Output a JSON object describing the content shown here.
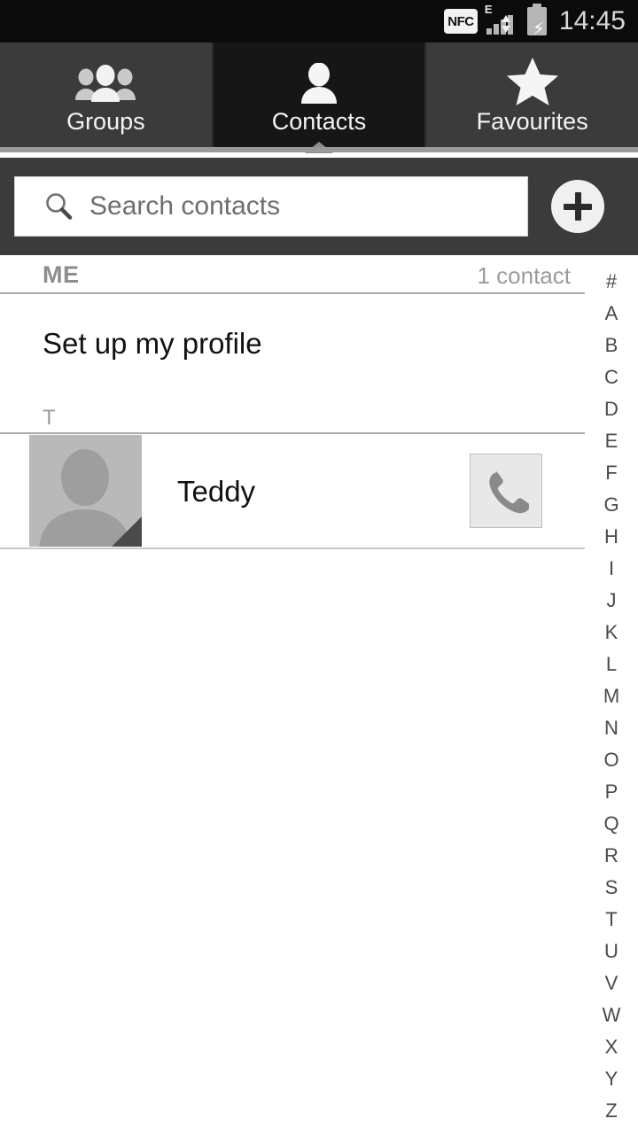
{
  "status_bar": {
    "nfc_label": "NFC",
    "network_type": "E",
    "time": "14:45",
    "signal_icon": "signal-bars-icon",
    "battery_icon": "battery-charging-icon",
    "data_arrows_icon": "data-transfer-icon"
  },
  "tabs": [
    {
      "label": "Groups",
      "icon": "people-group-icon",
      "selected": false
    },
    {
      "label": "Contacts",
      "icon": "person-icon",
      "selected": true
    },
    {
      "label": "Favourites",
      "icon": "star-icon",
      "selected": false
    }
  ],
  "search": {
    "placeholder": "Search contacts",
    "value": "",
    "icon": "search-icon",
    "add_icon": "plus-icon"
  },
  "sections": {
    "me": {
      "title": "ME",
      "count": "1 contact",
      "profile_row_label": "Set up my profile"
    },
    "t": {
      "title": "T",
      "contact_name": "Teddy",
      "avatar_icon": "person-placeholder-icon",
      "call_icon": "phone-handset-icon"
    }
  },
  "index": [
    "#",
    "A",
    "B",
    "C",
    "D",
    "E",
    "F",
    "G",
    "H",
    "I",
    "J",
    "K",
    "L",
    "M",
    "N",
    "O",
    "P",
    "Q",
    "R",
    "S",
    "T",
    "U",
    "V",
    "W",
    "X",
    "Y",
    "Z"
  ],
  "colors": {
    "status_bar_bg": "#0b0b0b",
    "tab_bg": "#3b3b3b",
    "tab_selected_bg": "#161616",
    "search_bg": "#3b3b3b",
    "list_bg": "#ffffff",
    "divider": "#a9a9a9",
    "text_primary": "#111111",
    "text_muted": "#9b9b9b"
  }
}
